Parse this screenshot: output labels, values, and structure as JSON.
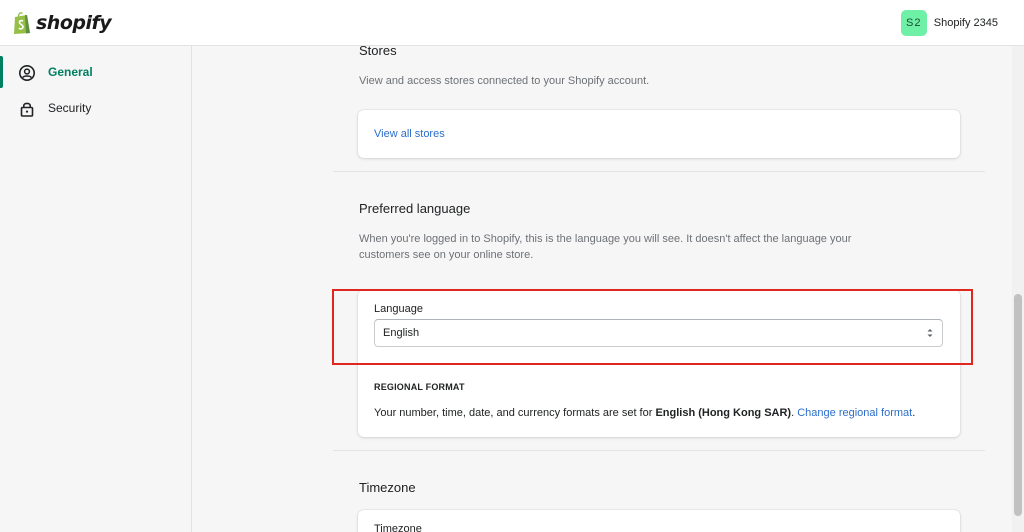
{
  "brand": {
    "name": "shopify",
    "color": "#95bf47"
  },
  "account": {
    "initials": "S2",
    "name": "Shopify 2345",
    "avatar_color": "#6ef0a7"
  },
  "sidebar": {
    "items": [
      {
        "label": "General",
        "icon": "user-circle-icon",
        "active": true
      },
      {
        "label": "Security",
        "icon": "lock-icon",
        "active": false
      }
    ]
  },
  "stores": {
    "title": "Stores",
    "description": "View and access stores connected to your Shopify account.",
    "link_label": "View all stores"
  },
  "language": {
    "title": "Preferred language",
    "description_line1": "When you're logged in to Shopify, this is the language you will see. It doesn't affect the language your",
    "description_line2": "customers see on your online store.",
    "field_label": "Language",
    "selected": "English",
    "regional_heading": "REGIONAL FORMAT",
    "regional_text_prefix": "Your number, time, date, and currency formats are set for ",
    "regional_locale": "English (Hong Kong SAR)",
    "regional_text_suffix": ". ",
    "regional_link": "Change regional format",
    "regional_end": "."
  },
  "timezone": {
    "title": "Timezone",
    "field_label": "Timezone"
  },
  "colors": {
    "accent": "#008060",
    "link": "#2c6ecb",
    "highlight": "#e0271f"
  }
}
